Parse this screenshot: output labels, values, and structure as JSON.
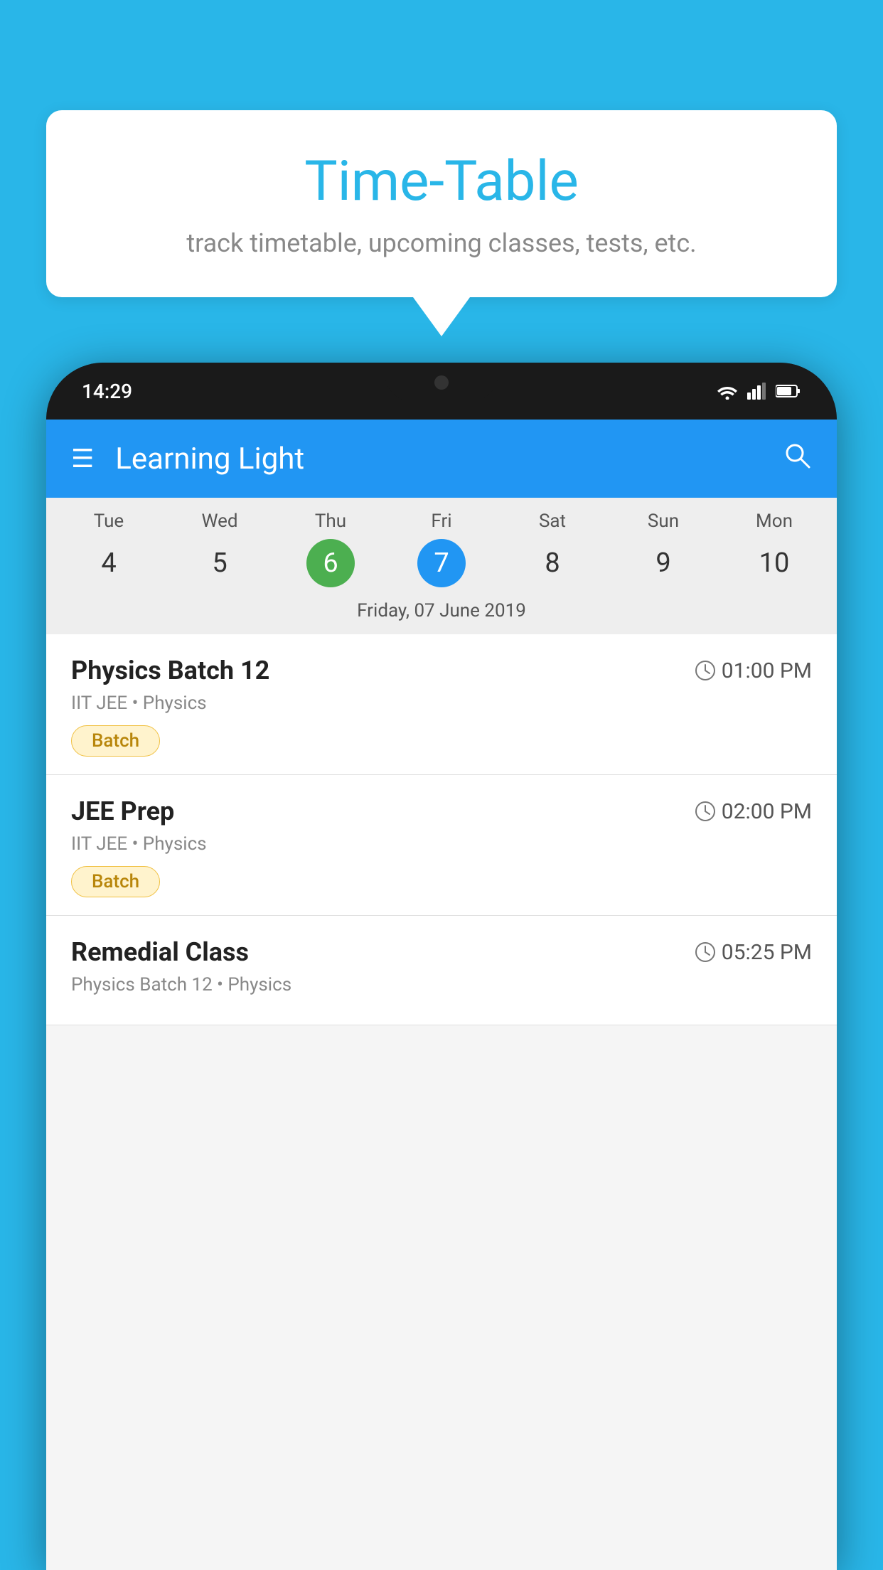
{
  "background_color": "#29B6E8",
  "speech_bubble": {
    "title": "Time-Table",
    "subtitle": "track timetable, upcoming classes, tests, etc."
  },
  "phone": {
    "status_bar": {
      "time": "14:29",
      "icons": [
        "wifi",
        "signal",
        "battery"
      ]
    },
    "header": {
      "app_name": "Learning Light",
      "menu_icon": "☰",
      "search_icon": "🔍"
    },
    "calendar": {
      "days": [
        {
          "name": "Tue",
          "number": "4",
          "state": "normal"
        },
        {
          "name": "Wed",
          "number": "5",
          "state": "normal"
        },
        {
          "name": "Thu",
          "number": "6",
          "state": "today"
        },
        {
          "name": "Fri",
          "number": "7",
          "state": "selected"
        },
        {
          "name": "Sat",
          "number": "8",
          "state": "normal"
        },
        {
          "name": "Sun",
          "number": "9",
          "state": "normal"
        },
        {
          "name": "Mon",
          "number": "10",
          "state": "normal"
        }
      ],
      "selected_date_label": "Friday, 07 June 2019"
    },
    "classes": [
      {
        "name": "Physics Batch 12",
        "time": "01:00 PM",
        "meta": "IIT JEE • Physics",
        "badge": "Batch"
      },
      {
        "name": "JEE Prep",
        "time": "02:00 PM",
        "meta": "IIT JEE • Physics",
        "badge": "Batch"
      },
      {
        "name": "Remedial Class",
        "time": "05:25 PM",
        "meta": "Physics Batch 12 • Physics",
        "badge": null
      }
    ]
  }
}
